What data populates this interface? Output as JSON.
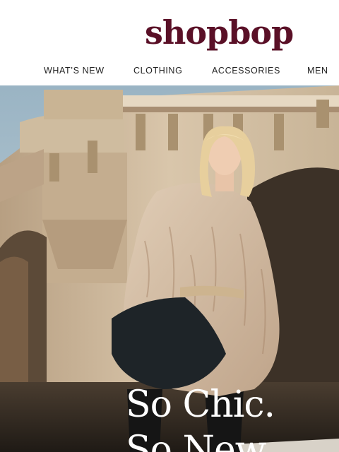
{
  "brand": {
    "logo_text": "shopbop",
    "logo_color": "#5a1027"
  },
  "nav": {
    "items": [
      {
        "label": "WHAT’S NEW"
      },
      {
        "label": "CLOTHING"
      },
      {
        "label": "ACCESSORIES"
      },
      {
        "label": "MEN"
      }
    ]
  },
  "hero": {
    "headline_line1": "So Chic.",
    "headline_line2": "So New."
  }
}
